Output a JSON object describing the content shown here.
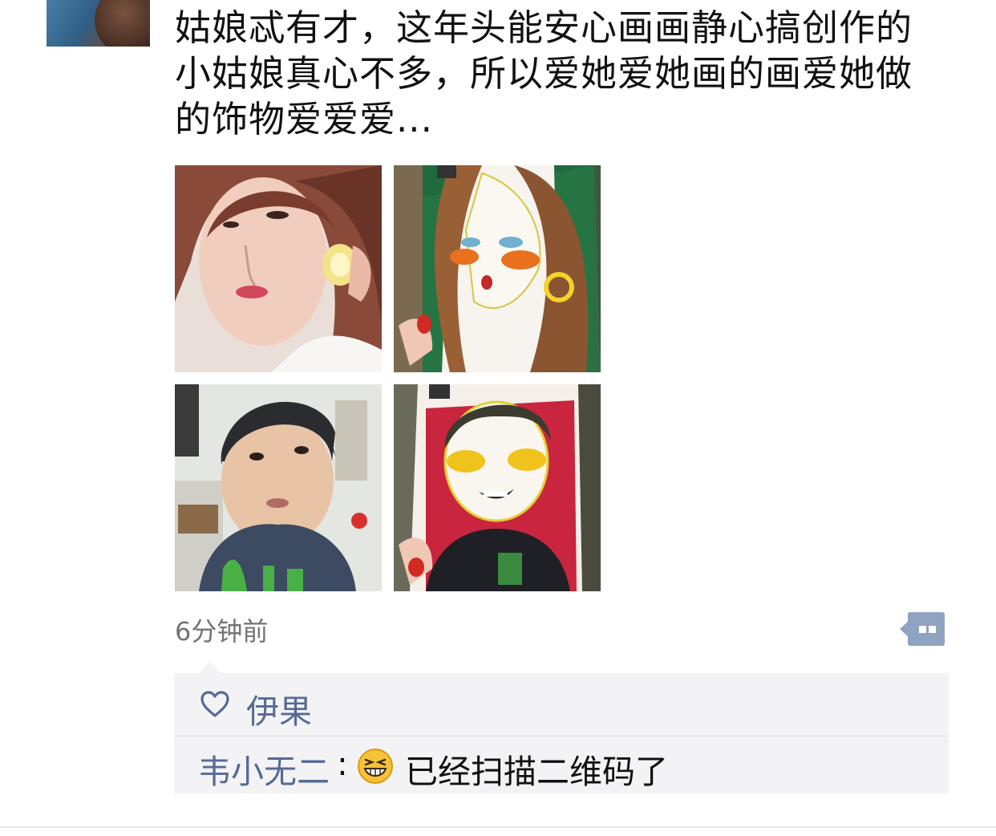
{
  "post": {
    "text_line1": "姑娘忒有才，这年头能安心画画静心搞创作的",
    "text_line2": "小姑娘真心不多，所以爱她爱她画的画爱她做",
    "text_line3": "的饰物爱爱爱..."
  },
  "photos": [
    {
      "icon": "selfie-woman-photo"
    },
    {
      "icon": "portrait-drawing-woman-photo"
    },
    {
      "icon": "selfie-boy-photo"
    },
    {
      "icon": "portrait-drawing-boy-photo"
    }
  ],
  "timestamp": "6分钟前",
  "actions": {
    "more_icon": "comment-more-icon",
    "color": "#8fa3c2"
  },
  "likes": {
    "icon": "heart-icon",
    "names": "伊果"
  },
  "comments": [
    {
      "author": "韦小无二",
      "separator": ":",
      "emoji": "grinning-face-emoji",
      "text": "已经扫描二维码了"
    }
  ],
  "colors": {
    "link": "#566b94",
    "panel": "#f3f3f5",
    "timestamp": "#737373"
  }
}
